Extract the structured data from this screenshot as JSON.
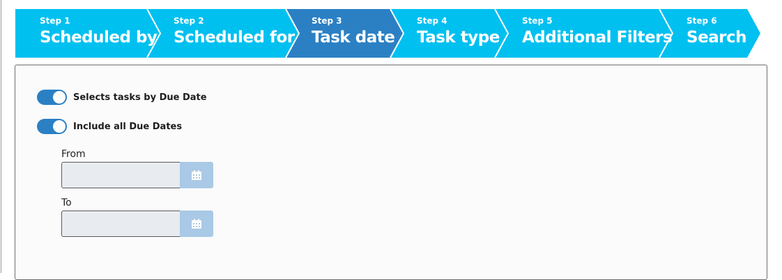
{
  "wizard": {
    "steps": [
      {
        "num": "Step 1",
        "title": "Scheduled by"
      },
      {
        "num": "Step 2",
        "title": "Scheduled for"
      },
      {
        "num": "Step 3",
        "title": "Task date"
      },
      {
        "num": "Step 4",
        "title": "Task type"
      },
      {
        "num": "Step 5",
        "title": "Additional Filters"
      },
      {
        "num": "Step 6",
        "title": "Search"
      }
    ],
    "active_step": 3,
    "colors": {
      "inactive": "#00c0f0",
      "active": "#2b80c4",
      "separator": "#ffffff"
    }
  },
  "form": {
    "toggle_due_date": {
      "label": "Selects tasks by Due Date",
      "on": true
    },
    "toggle_all_due": {
      "label": "Include all Due Dates",
      "on": true
    },
    "from": {
      "label": "From",
      "value": ""
    },
    "to": {
      "label": "To",
      "value": ""
    },
    "calendar_icon": "calendar-icon"
  }
}
